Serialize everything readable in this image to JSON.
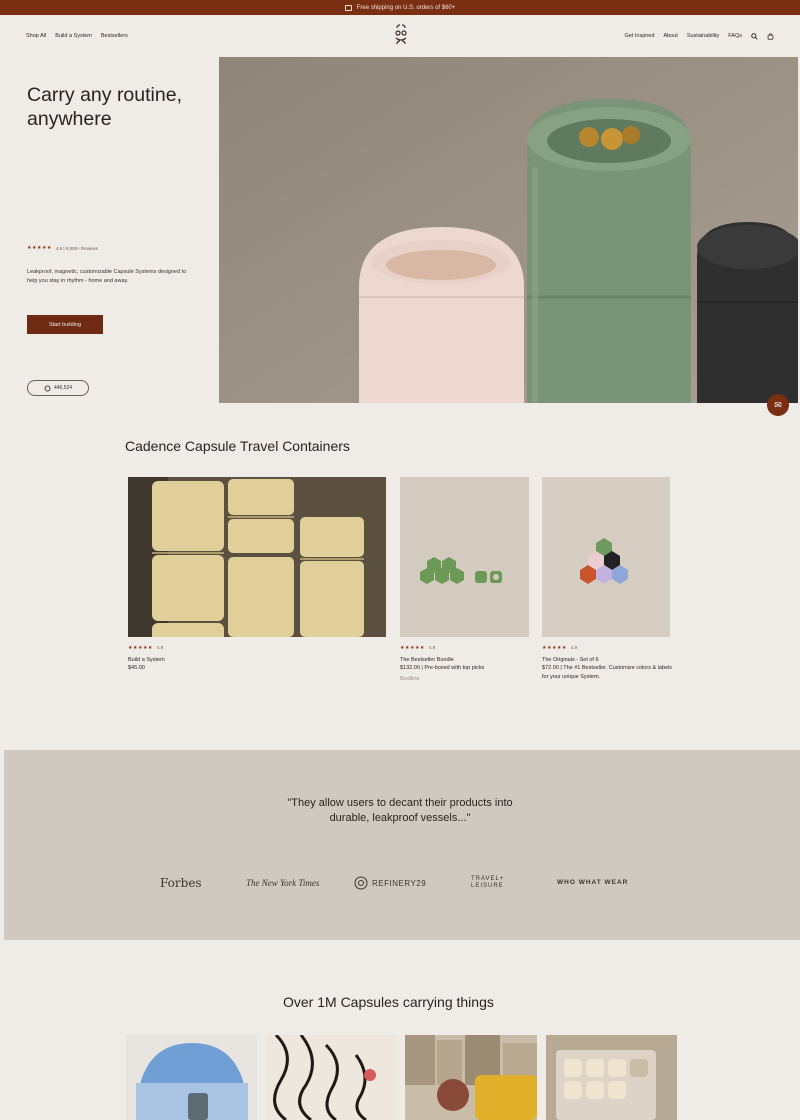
{
  "announcement": {
    "text": "Free shipping on U.S. orders of $60+",
    "icon": "gift-icon"
  },
  "nav": {
    "left": [
      "Shop All",
      "Build a System",
      "Bestsellers"
    ],
    "right": [
      "Get Inspired",
      "About",
      "Sustainability",
      "FAQs"
    ],
    "icons": [
      "search-icon",
      "cart-icon"
    ]
  },
  "hero": {
    "title": "Carry any routine, anywhere",
    "rating_text": "4.8 | 6,000+ Reviews",
    "stars": "★★★★★",
    "description": "Leakproof, magnetic, customizable Capsule Systems designed to help you stay in rhythm - home and away.",
    "cta": "Start building",
    "pill": "446,524"
  },
  "products_section": {
    "title": "Cadence Capsule Travel Containers",
    "cards": [
      {
        "stars": "★★★★★",
        "rating": "4.9",
        "name": "Build a System",
        "price": "$45.00",
        "extra": ""
      },
      {
        "stars": "★★★★★",
        "rating": "4.9",
        "name": "The Bestseller Bundle",
        "price": "$132.00 | Pre-boxed with top picks",
        "extra": "Bestline"
      },
      {
        "stars": "★★★★★",
        "rating": "4.9",
        "name": "The Originals - Set of 6",
        "price": "$72.00 | The #1 Bestseller. Customize colors & labels for your unique System.",
        "extra": ""
      }
    ]
  },
  "press": {
    "quote": "\"They allow users to decant their products into durable, leakproof vessels...\"",
    "logos": [
      "Forbes",
      "The New York Times",
      "REFINERY29",
      "TRAVEL+ LEISURE",
      "WHO WHAT WEAR"
    ]
  },
  "community": {
    "title": "Over 1M Capsules carrying things"
  },
  "colors": {
    "brand": "#7a2e12",
    "background": "#efebe6",
    "press_band": "#cfc9c1"
  }
}
